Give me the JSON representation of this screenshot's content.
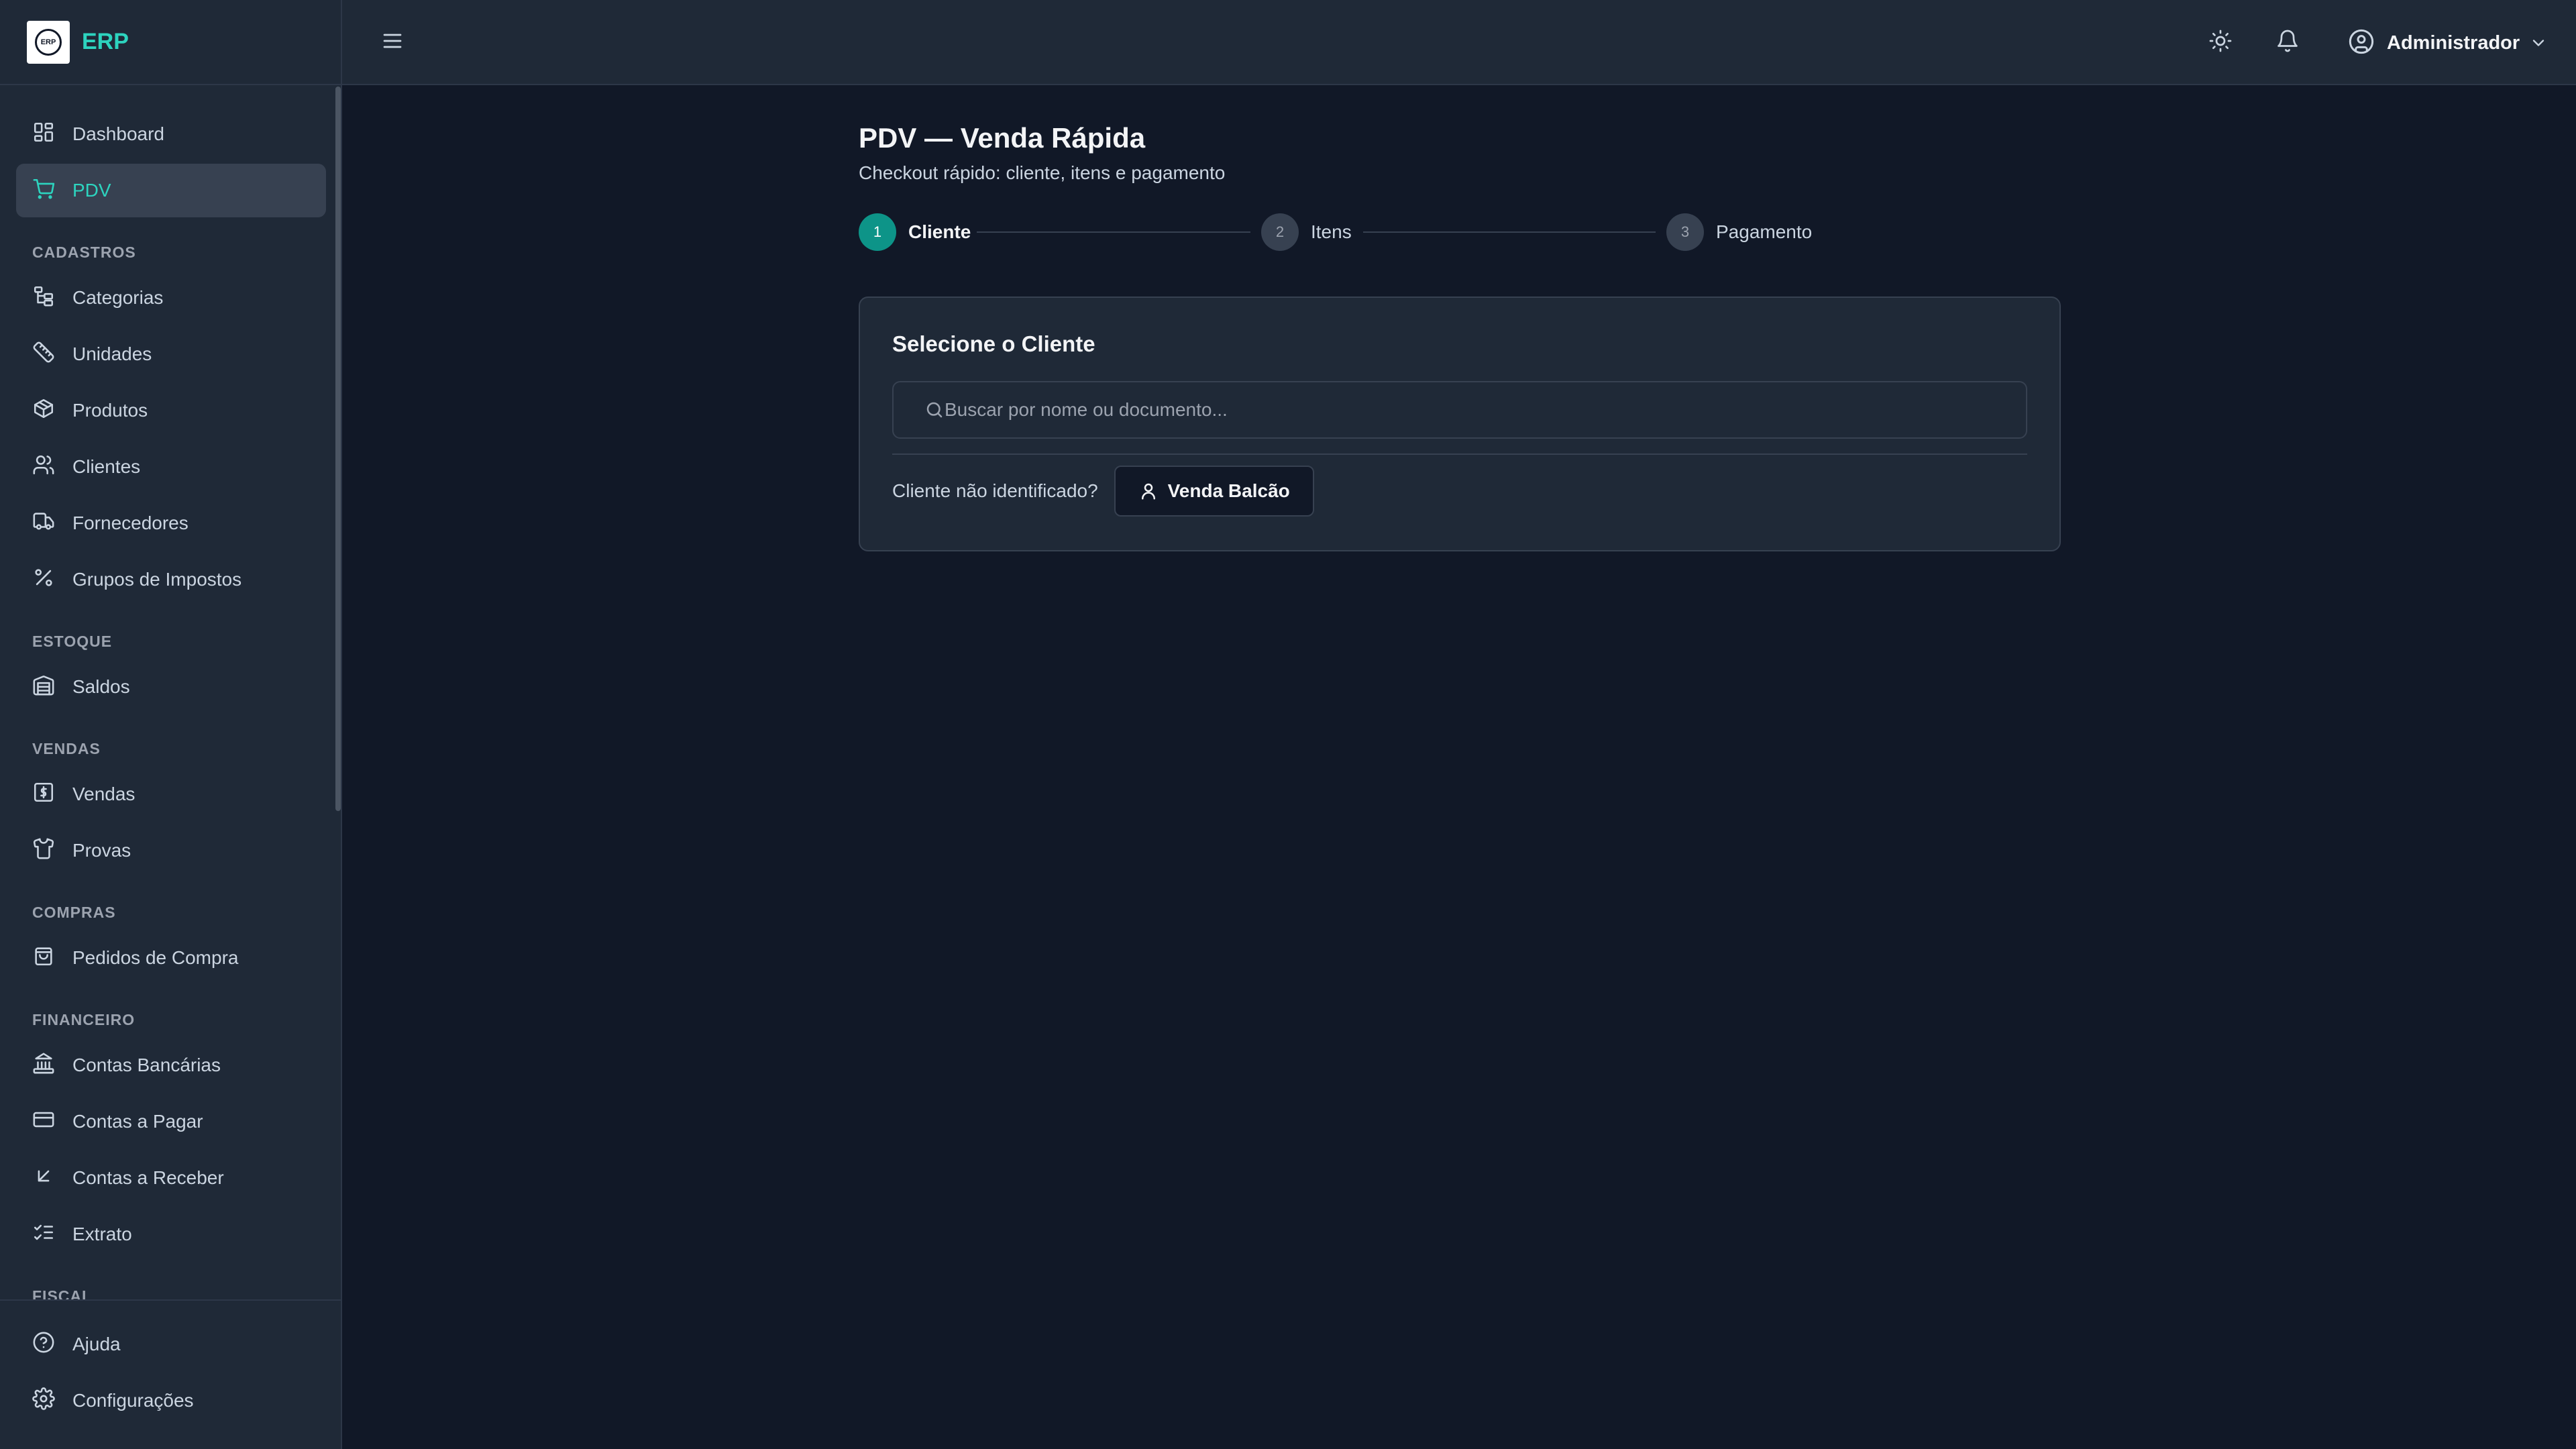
{
  "app": {
    "name": "ERP",
    "logo_text": "ERP"
  },
  "sidebar": {
    "items": [
      {
        "label": "Dashboard",
        "icon": "layout-dashboard-icon",
        "active": false
      },
      {
        "label": "PDV",
        "icon": "shopping-cart-icon",
        "active": true
      }
    ],
    "sections": [
      {
        "title": "CADASTROS",
        "items": [
          {
            "label": "Categorias",
            "icon": "folder-tree-icon"
          },
          {
            "label": "Unidades",
            "icon": "ruler-icon"
          },
          {
            "label": "Produtos",
            "icon": "package-icon"
          },
          {
            "label": "Clientes",
            "icon": "users-icon"
          },
          {
            "label": "Fornecedores",
            "icon": "truck-icon"
          },
          {
            "label": "Grupos de Impostos",
            "icon": "percent-icon"
          }
        ]
      },
      {
        "title": "ESTOQUE",
        "items": [
          {
            "label": "Saldos",
            "icon": "warehouse-icon"
          }
        ]
      },
      {
        "title": "VENDAS",
        "items": [
          {
            "label": "Vendas",
            "icon": "receipt-dollar-icon"
          },
          {
            "label": "Provas",
            "icon": "shirt-icon"
          }
        ]
      },
      {
        "title": "COMPRAS",
        "items": [
          {
            "label": "Pedidos de Compra",
            "icon": "shopping-bag-icon"
          }
        ]
      },
      {
        "title": "FINANCEIRO",
        "items": [
          {
            "label": "Contas Bancárias",
            "icon": "landmark-icon"
          },
          {
            "label": "Contas a Pagar",
            "icon": "credit-card-icon"
          },
          {
            "label": "Contas a Receber",
            "icon": "arrow-down-left-icon"
          },
          {
            "label": "Extrato",
            "icon": "list-checks-icon"
          }
        ]
      },
      {
        "title": "FISCAL",
        "items": []
      }
    ],
    "footer": [
      {
        "label": "Ajuda",
        "icon": "help-circle-icon"
      },
      {
        "label": "Configurações",
        "icon": "settings-icon"
      }
    ]
  },
  "topbar": {
    "user_name": "Administrador",
    "icons": [
      "menu-icon",
      "sun-icon",
      "bell-icon",
      "user-circle-icon",
      "chevron-down-icon"
    ]
  },
  "page": {
    "title": "PDV — Venda Rápida",
    "subtitle": "Checkout rápido: cliente, itens e pagamento"
  },
  "stepper": {
    "current": 1,
    "steps": [
      {
        "number": "1",
        "label": "Cliente"
      },
      {
        "number": "2",
        "label": "Itens"
      },
      {
        "number": "3",
        "label": "Pagamento"
      }
    ]
  },
  "client_card": {
    "title": "Selecione o Cliente",
    "search_placeholder": "Buscar por nome ou documento...",
    "search_value": "",
    "unidentified_text": "Cliente não identificado?",
    "counter_sale_label": "Venda Balcão"
  },
  "colors": {
    "accent": "#2dd4bf",
    "step_active": "#0d9488",
    "background": "#111827",
    "surface": "#1f2937",
    "border": "#374151"
  }
}
